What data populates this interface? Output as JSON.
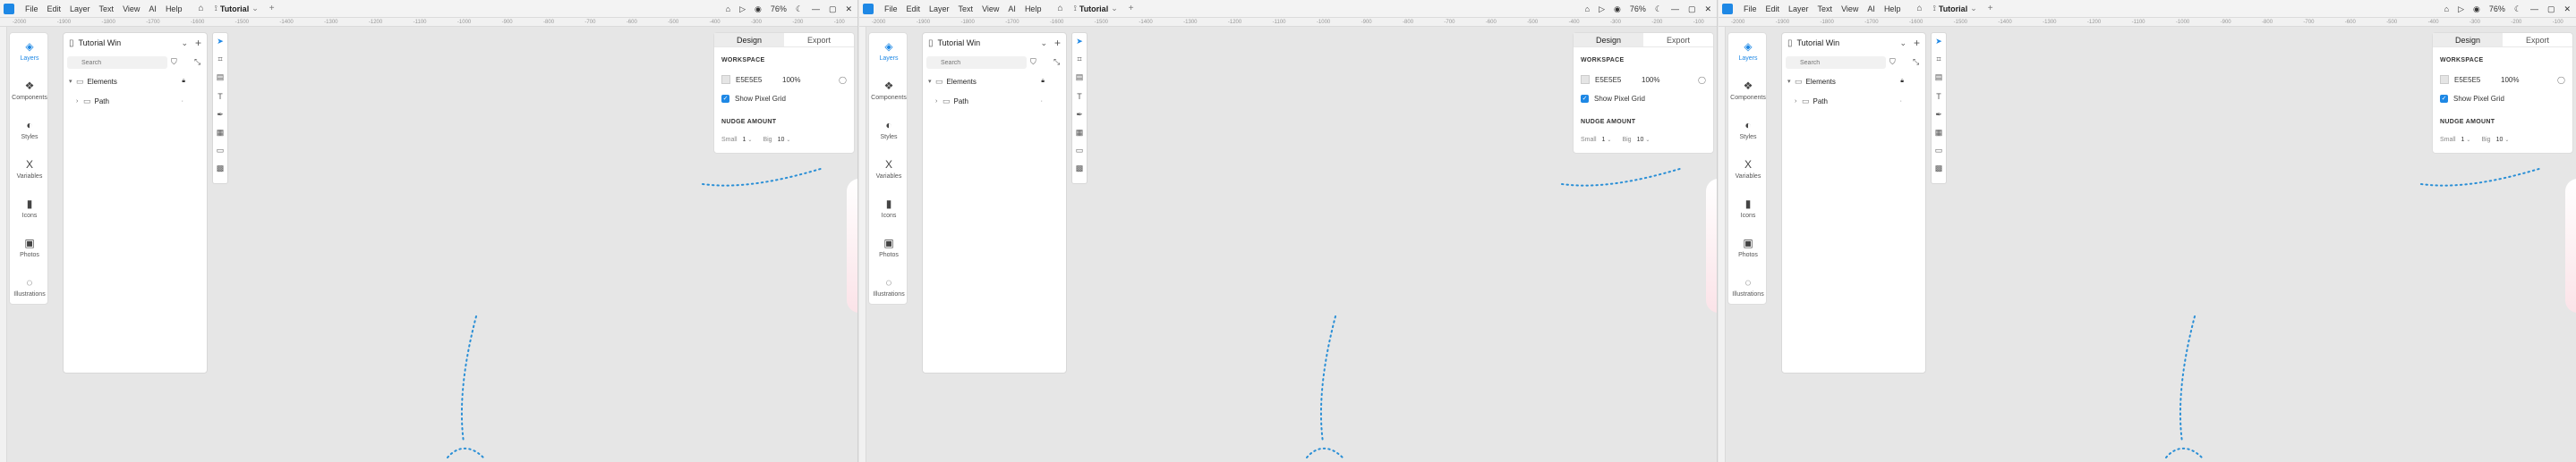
{
  "menubar": {
    "items": [
      "File",
      "Edit",
      "Layer",
      "Text",
      "View",
      "AI",
      "Help"
    ],
    "doc_tab": "Tutorial",
    "zoom": "76%"
  },
  "ruler": {
    "ticks": [
      "-2000",
      "-1900",
      "-1800",
      "-1700",
      "-1600",
      "-1500",
      "-1400",
      "-1300",
      "-1200",
      "-1100",
      "-1000",
      "-900",
      "-800",
      "-700",
      "-600",
      "-500",
      "-400",
      "-300",
      "-200",
      "-100"
    ]
  },
  "nav": {
    "items": [
      {
        "label": "Layers",
        "icon": "layers-icon"
      },
      {
        "label": "Components",
        "icon": "components-icon"
      },
      {
        "label": "Styles",
        "icon": "styles-icon"
      },
      {
        "label": "Variables",
        "icon": "variables-icon"
      },
      {
        "label": "Icons",
        "icon": "icons-icon"
      },
      {
        "label": "Photos",
        "icon": "photos-icon"
      },
      {
        "label": "Illustrations",
        "icon": "illustrations-icon"
      }
    ]
  },
  "layers": {
    "file_name": "Tutorial Win",
    "search_placeholder": "Search",
    "rows": [
      {
        "label": "Elements"
      },
      {
        "label": "Path"
      }
    ]
  },
  "properties": {
    "tabs": [
      "Design",
      "Export"
    ],
    "workspace_title": "WORKSPACE",
    "bg_hex": "E5E5E5",
    "bg_opacity": "100%",
    "pixel_grid_label": "Show Pixel Grid",
    "nudge_title": "NUDGE AMOUNT",
    "small_label": "Small",
    "small_value": "1",
    "big_label": "Big",
    "big_value": "10"
  },
  "colors": {
    "accent": "#1e88e5",
    "path": "#2a8fd6",
    "canvas": "#e6e6e6"
  }
}
